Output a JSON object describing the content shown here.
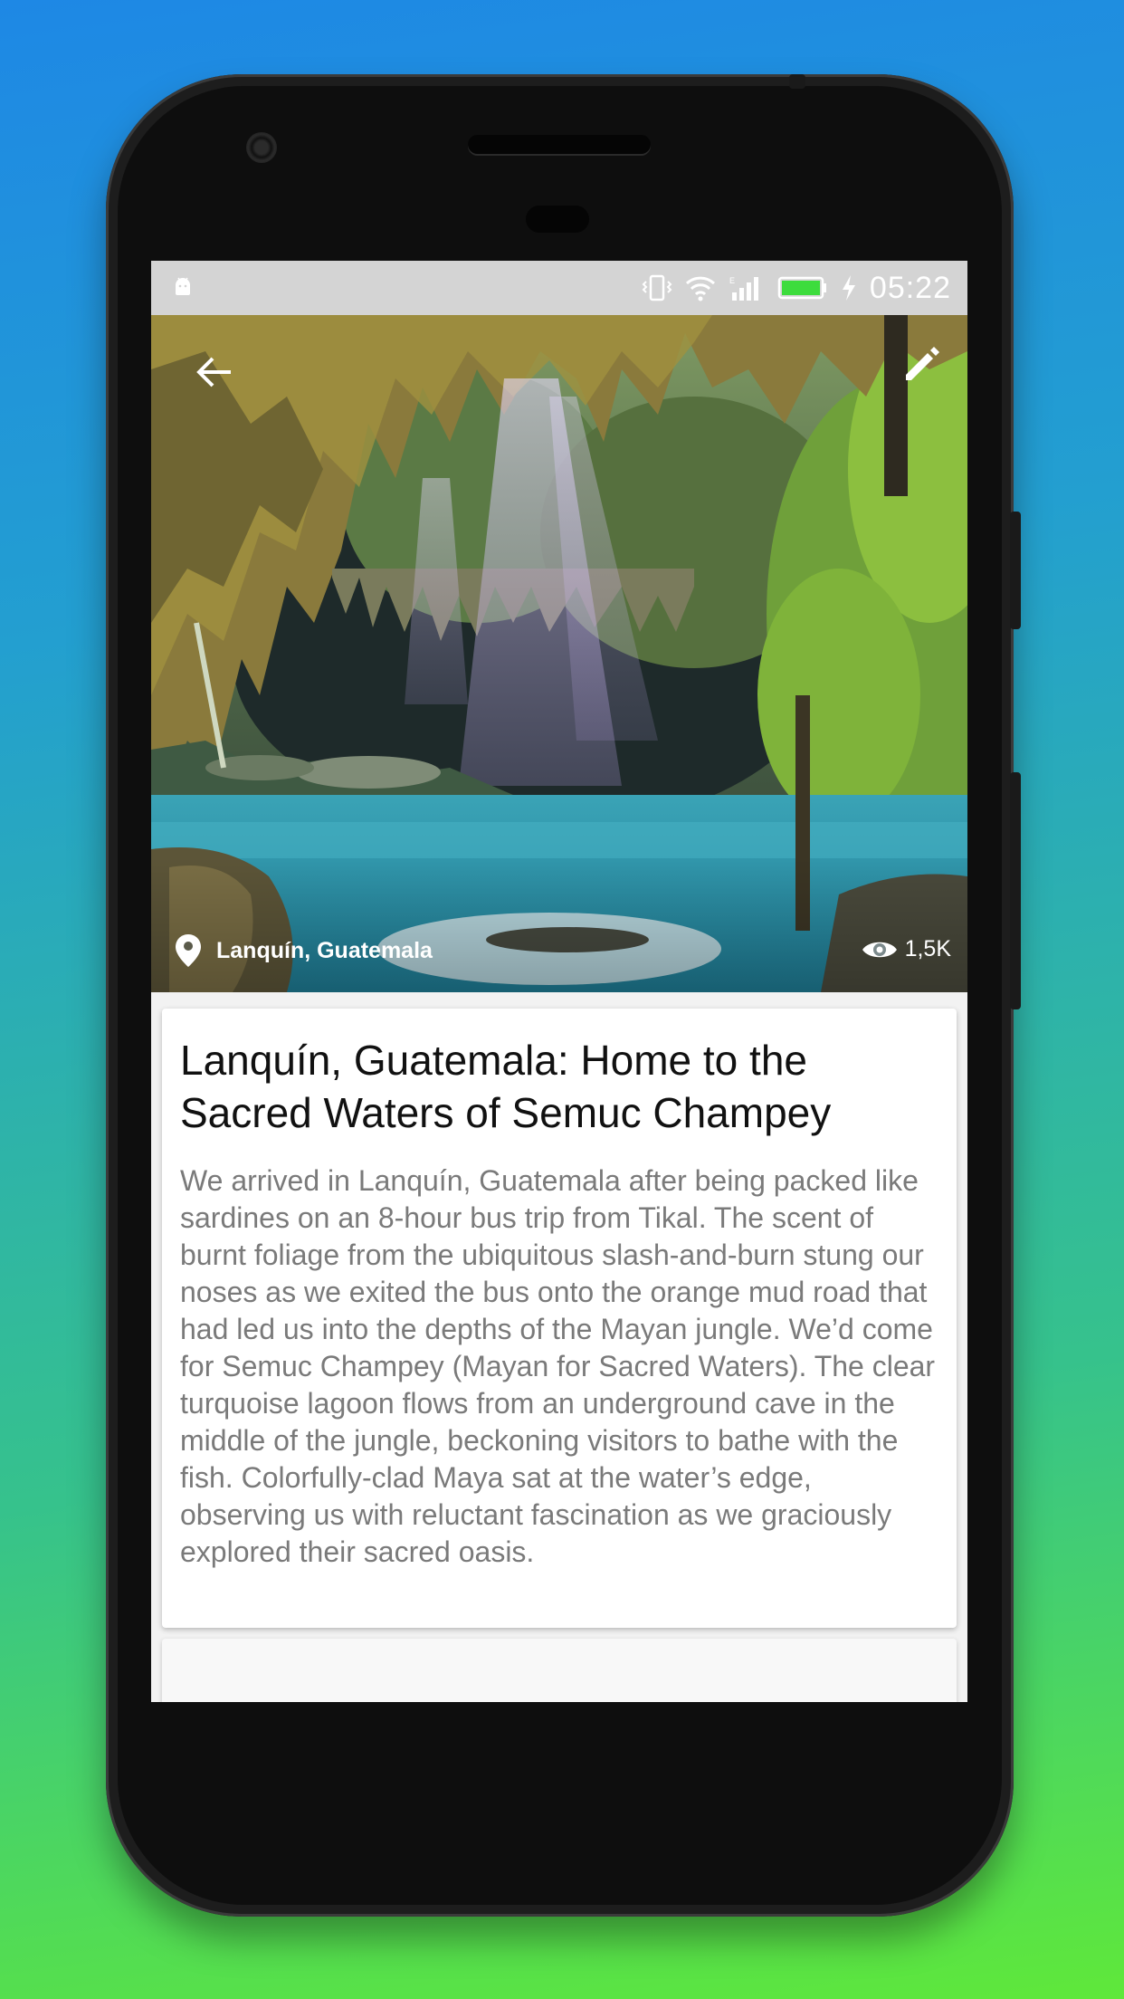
{
  "status_bar": {
    "time": "05:22",
    "icons": [
      "android-notification-icon",
      "vibrate-icon",
      "wifi-icon",
      "signal-icon",
      "battery-icon",
      "charging-icon"
    ],
    "battery_color": "#3ddc3d"
  },
  "hero": {
    "location": "Lanquín, Guatemala",
    "views": "1,5K",
    "icons": [
      "back-arrow-icon",
      "edit-pencil-icon",
      "location-pin-icon",
      "eye-icon"
    ]
  },
  "article": {
    "title": "Lanquín, Guatemala: Home to the Sacred Waters of Semuc Champey",
    "body": "We arrived in Lanquín, Guatemala after being packed like sardines on an 8-hour bus trip from Tikal. The scent of burnt foliage from the ubiquitous slash-and-burn stung our noses as we exited the bus onto the orange mud road that had led us into the depths of the Mayan jungle. We’d come for Semuc Champey (Mayan for Sacred Waters). The clear turquoise lagoon flows from an underground cave in the middle of the jungle, beckoning visitors to bathe with the fish. Colorfully-clad Maya sat at the water’s edge, observing us with reluctant fascination as we graciously explored their sacred oasis."
  },
  "colors": {
    "background_top": "#1e88e5",
    "background_bottom": "#5fe83a",
    "title_text": "#111111",
    "body_text": "#7a7a7a"
  }
}
